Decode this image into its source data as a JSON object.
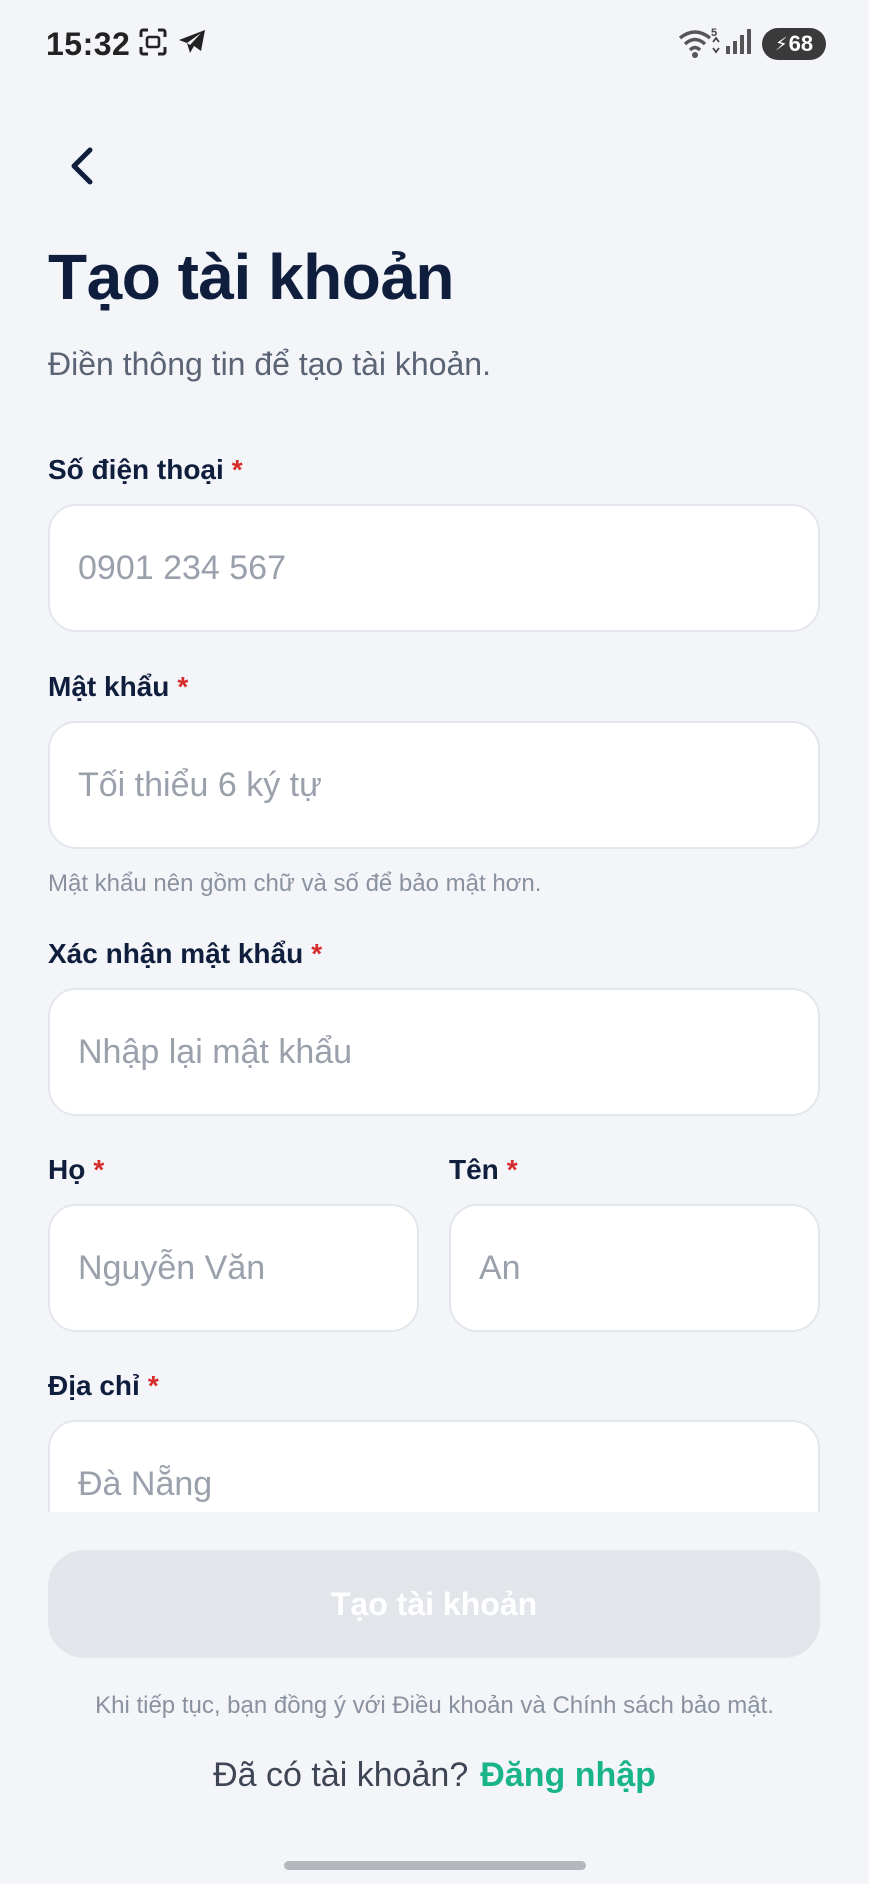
{
  "status_bar": {
    "time": "15:32",
    "battery_level": "68",
    "wifi_label": "5",
    "icons": [
      "screenshot-scan-icon",
      "telegram-icon",
      "wifi-icon",
      "signal-icon",
      "battery-charging-icon"
    ]
  },
  "header": {
    "back_icon": "chevron-left-icon",
    "title": "Tạo tài khoản",
    "subtitle": "Điền thông tin để tạo tài khoản."
  },
  "form": {
    "required_mark": "*",
    "phone": {
      "label": "Số điện thoại",
      "placeholder": "0901 234 567",
      "value": ""
    },
    "password": {
      "label": "Mật khẩu",
      "placeholder": "Tối thiểu 6 ký tự",
      "value": "",
      "helper": "Mật khẩu nên gồm chữ và số để bảo mật hơn."
    },
    "confirm_password": {
      "label": "Xác nhận mật khẩu",
      "placeholder": "Nhập lại mật khẩu",
      "value": ""
    },
    "last_name": {
      "label": "Họ",
      "placeholder": "Nguyễn Văn",
      "value": ""
    },
    "first_name": {
      "label": "Tên",
      "placeholder": "An",
      "value": ""
    },
    "address": {
      "label": "Địa chỉ",
      "placeholder": "Đà Nẵng",
      "value": ""
    }
  },
  "submit": {
    "label": "Tạo tài khoản",
    "enabled": false
  },
  "footer": {
    "terms": "Khi tiếp tục, bạn đồng ý với Điều khoản và Chính sách bảo mật.",
    "login_prompt": "Đã có tài khoản?",
    "login_link": "Đăng nhập"
  },
  "colors": {
    "background": "#F4F5F9",
    "title": "#0F1E3D",
    "required": "#D62B2B",
    "accent": "#19B48A",
    "button_disabled": "#E2E6EB",
    "input_border": "#E3E6EC"
  }
}
